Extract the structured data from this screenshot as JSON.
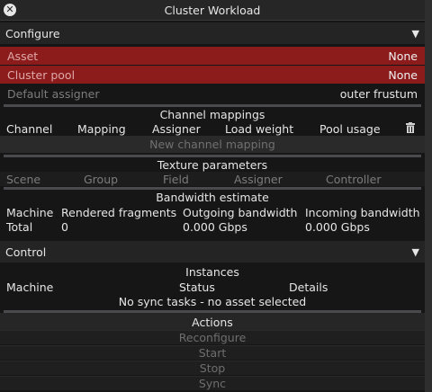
{
  "window": {
    "title": "Cluster Workload"
  },
  "configure": {
    "header": "Configure",
    "asset_label": "Asset",
    "asset_value": "None",
    "pool_label": "Cluster pool",
    "pool_value": "None",
    "assigner_label": "Default assigner",
    "assigner_value": "outer frustum"
  },
  "channel_mappings": {
    "title": "Channel mappings",
    "columns": [
      "Channel",
      "Mapping",
      "Assigner",
      "Load weight",
      "Pool usage"
    ],
    "new_label": "New channel mapping"
  },
  "texture": {
    "title": "Texture parameters",
    "columns": [
      "Scene",
      "Group",
      "Field",
      "Assigner",
      "Controller"
    ]
  },
  "bandwidth": {
    "title": "Bandwidth estimate",
    "columns": [
      "Machine",
      "Rendered fragments",
      "Outgoing bandwidth",
      "Incoming bandwidth"
    ],
    "total": [
      "Total",
      "0",
      "0.000 Gbps",
      "0.000 Gbps"
    ]
  },
  "control": {
    "header": "Control",
    "instances_title": "Instances",
    "columns": [
      "Machine",
      "Status",
      "Details"
    ],
    "empty_message": "No sync tasks - no asset selected"
  },
  "actions": {
    "title": "Actions",
    "buttons": [
      "Reconfigure",
      "Start",
      "Stop",
      "Sync"
    ]
  },
  "icons": {
    "close": "close-icon",
    "trash": "trash-icon",
    "collapse": "triangle-down-icon"
  }
}
